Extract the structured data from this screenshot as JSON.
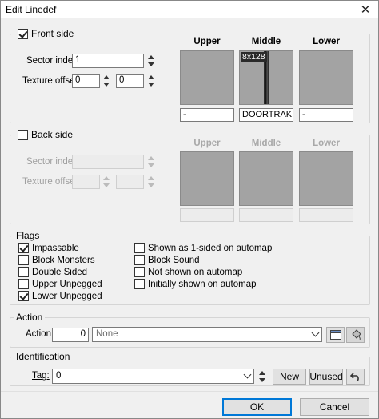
{
  "window": {
    "title": "Edit Linedef",
    "close_glyph": "✕"
  },
  "front_side": {
    "legend": "Front side",
    "checked": true,
    "sector_index_label": "Sector index:",
    "sector_index_value": "1",
    "texture_offset_label": "Texture offset:",
    "offset_x": "0",
    "offset_y": "0",
    "columns": [
      "Upper",
      "Middle",
      "Lower"
    ],
    "middle_texture_size": "8x128",
    "texture_names": [
      "-",
      "DOORTRAK",
      "-"
    ]
  },
  "back_side": {
    "legend": "Back side",
    "checked": false,
    "sector_index_label": "Sector index:",
    "texture_offset_label": "Texture offset:",
    "columns": [
      "Upper",
      "Middle",
      "Lower"
    ]
  },
  "flags": {
    "legend": "Flags",
    "left": [
      {
        "label": "Impassable",
        "checked": true
      },
      {
        "label": "Block Monsters",
        "checked": false
      },
      {
        "label": "Double Sided",
        "checked": false
      },
      {
        "label": "Upper Unpegged",
        "checked": false
      },
      {
        "label": "Lower Unpegged",
        "checked": true
      }
    ],
    "right": [
      {
        "label": "Shown as 1-sided on automap",
        "checked": false
      },
      {
        "label": "Block Sound",
        "checked": false
      },
      {
        "label": "Not shown on automap",
        "checked": false
      },
      {
        "label": "Initially shown on automap",
        "checked": false
      }
    ]
  },
  "action": {
    "legend": "Action",
    "label": "Action:",
    "value": "0",
    "selected": "None",
    "icons": [
      "script-browser-icon",
      "paint-bucket-icon"
    ]
  },
  "identification": {
    "legend": "Identification",
    "tag_label": "Tag:",
    "tag_value": "0",
    "new_label": "New",
    "unused_label": "Unused",
    "undo_icon": "undo-icon"
  },
  "footer": {
    "ok_label": "OK",
    "cancel_label": "Cancel"
  }
}
